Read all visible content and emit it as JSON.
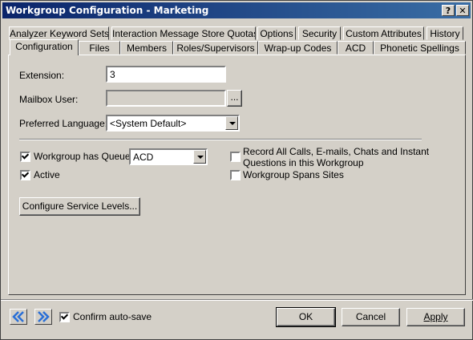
{
  "window": {
    "title": "Workgroup Configuration - Marketing",
    "help_label": "?",
    "close_label": "✕"
  },
  "tabs_row1": [
    "Analyzer Keyword Sets",
    "Interaction Message Store Quotas",
    "Options",
    "Security",
    "Custom Attributes",
    "History"
  ],
  "tabs_row2": [
    "Configuration",
    "Files",
    "Members",
    "Roles/Supervisors",
    "Wrap-up Codes",
    "ACD",
    "Phonetic Spellings"
  ],
  "active_tab": "Configuration",
  "form": {
    "extension_label": "Extension:",
    "extension_value": "3",
    "mailbox_label": "Mailbox User:",
    "mailbox_value": "",
    "browse_label": "...",
    "language_label": "Preferred Language:",
    "language_value": "<System Default>",
    "has_queue_label": "Workgroup has Queue",
    "has_queue_checked": true,
    "queue_type_value": "ACD",
    "active_label": "Active",
    "active_checked": true,
    "record_label_line1": "Record All Calls, E-mails, Chats and Instant",
    "record_label_line2": "Questions in this Workgroup",
    "record_checked": false,
    "spans_sites_label": "Workgroup Spans Sites",
    "spans_sites_checked": false,
    "service_levels_label": "Configure Service Levels..."
  },
  "footer": {
    "confirm_autosave_label": "Confirm auto-save",
    "confirm_autosave_checked": true,
    "ok_label": "OK",
    "cancel_label": "Cancel",
    "apply_label": "Apply"
  },
  "colors": {
    "dialog_bg": "#d4d0c8",
    "title_start": "#0a246a",
    "title_end": "#3a6ea5",
    "nav_arrow": "#2a6fd6"
  },
  "icons": {
    "prev": "double-chevron-left-icon",
    "next": "double-chevron-right-icon"
  }
}
